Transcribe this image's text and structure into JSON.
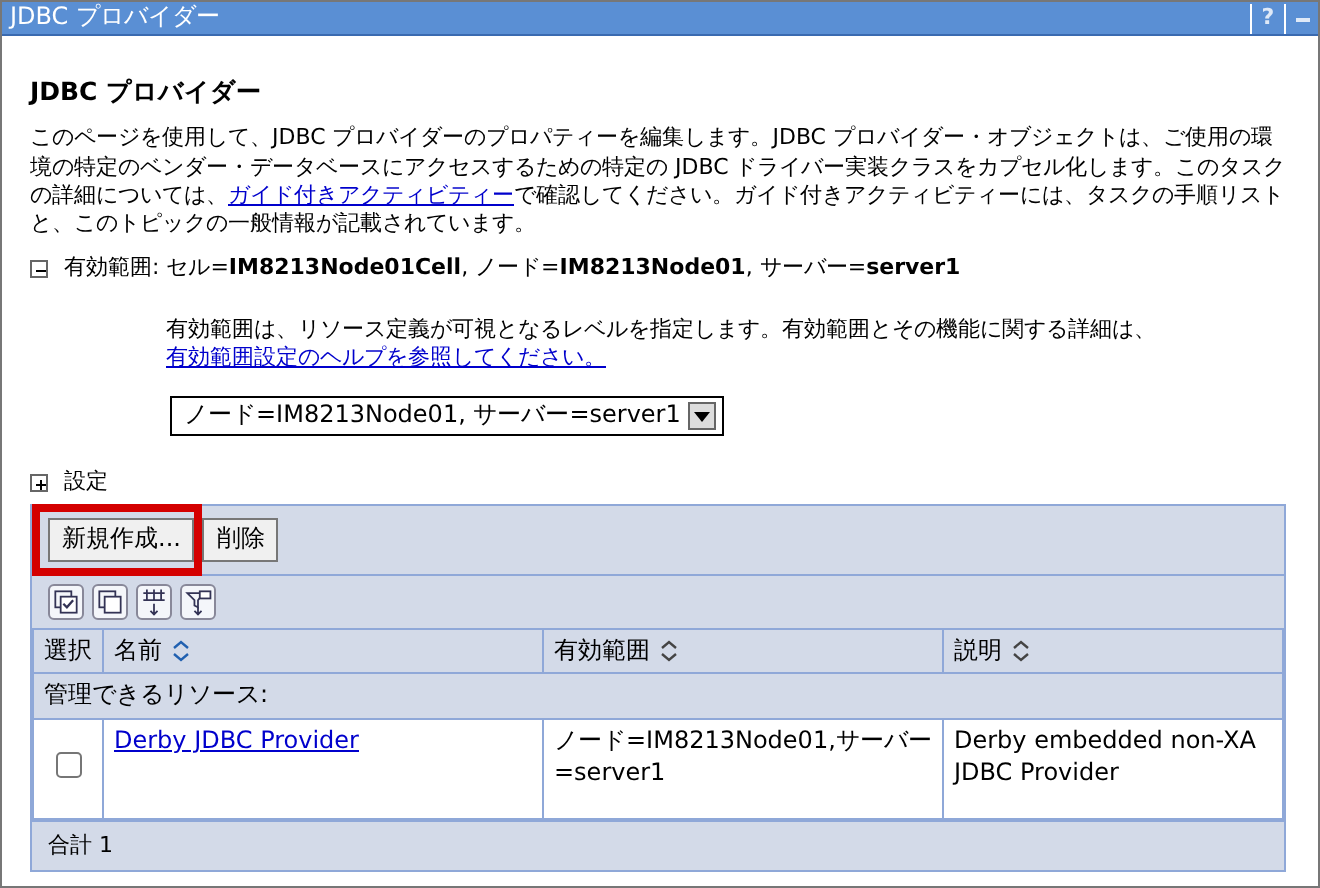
{
  "window": {
    "title": "JDBC プロバイダー",
    "help": "?"
  },
  "heading": "JDBC プロバイダー",
  "description": {
    "before": "このページを使用して、JDBC プロバイダーのプロパティーを編集します。JDBC プロバイダー・オブジェクトは、ご使用の環境の特定のベンダー・データベースにアクセスするための特定の JDBC ドライバー実装クラスをカプセル化します。このタスクの詳細については、",
    "link": "ガイド付きアクティビティー",
    "after": "で確認してください。ガイド付きアクティビティーには、タスクの手順リストと、このトピックの一般情報が記載されています。"
  },
  "scope": {
    "expanded": true,
    "label": "有効範囲:",
    "value": "セル=**IM8213Node01Cell**, ノード=**IM8213Node01**, サーバー=**server1**",
    "help_text": "有効範囲は、リソース定義が可視となるレベルを指定します。有効範囲とその機能に関する詳細は、",
    "help_link": "有効範囲設定のヘルプを参照してください。",
    "select_value": "ノード=IM8213Node01, サーバー=server1"
  },
  "settings": {
    "expanded": false,
    "label": "設定"
  },
  "buttons": [
    {
      "label": "新規作成...",
      "highlighted": true
    },
    {
      "label": "削除",
      "highlighted": false
    }
  ],
  "table": {
    "columns": [
      {
        "label": "選択",
        "sortable": false
      },
      {
        "label": "名前",
        "sortable": true
      },
      {
        "label": "有効範囲",
        "sortable": true
      },
      {
        "label": "説明",
        "sortable": true
      }
    ],
    "section": "管理できるリソース:",
    "rows": [
      {
        "selected": false,
        "name": "Derby JDBC Provider",
        "scope": "ノード=IM8213Node01,サーバー=server1",
        "description": "Derby embedded non-XA JDBC Provider"
      }
    ],
    "footer": "合計 1"
  }
}
